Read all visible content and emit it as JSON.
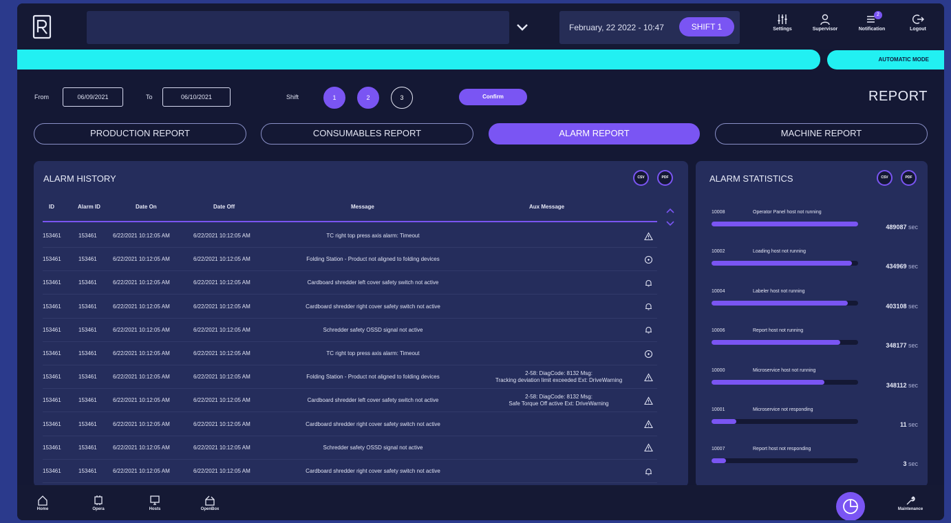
{
  "topbar": {
    "machine_select_value": "",
    "datetime": "February, 22 2022 - 10:47",
    "shift_label": "SHIFT 1",
    "settings_label": "Settings",
    "supervisor_label": "Supervisor",
    "notification_label": "Notification",
    "notification_count": "2",
    "logout_label": "Logout"
  },
  "mode": {
    "label": "AUTOMATIC MODE"
  },
  "filters": {
    "from_label": "From",
    "from_value": "06/09/2021",
    "to_label": "To",
    "to_value": "06/10/2021",
    "shift_label": "Shift",
    "shifts": [
      "1",
      "2",
      "3"
    ],
    "confirm_label": "Confirm"
  },
  "page_title": "REPORT",
  "tabs": [
    "PRODUCTION REPORT",
    "CONSUMABLES REPORT",
    "ALARM REPORT",
    "MACHINE REPORT"
  ],
  "alarm_history": {
    "title": "ALARM HISTORY",
    "csv_label": "CSV",
    "pdf_label": "PDF",
    "columns": [
      "ID",
      "Alarm ID",
      "Date On",
      "Date Off",
      "Message",
      "Aux Message"
    ],
    "rows": [
      {
        "id": "153461",
        "alarm_id": "153461",
        "date_on": "6/22/2021 10:12:05 AM",
        "date_off": "6/22/2021 10:12:05 AM",
        "message": "TC right top press axis alarm: Timeout",
        "aux1": "",
        "aux2": "",
        "icon": "warning-icon"
      },
      {
        "id": "153461",
        "alarm_id": "153461",
        "date_on": "6/22/2021 10:12:05 AM",
        "date_off": "6/22/2021 10:12:05 AM",
        "message": "Folding Station - Product not aligned to folding devices",
        "aux1": "",
        "aux2": "",
        "icon": "info-circle-icon"
      },
      {
        "id": "153461",
        "alarm_id": "153461",
        "date_on": "6/22/2021 10:12:05 AM",
        "date_off": "6/22/2021 10:12:05 AM",
        "message": "Cardboard shredder left cover safety switch not active",
        "aux1": "",
        "aux2": "",
        "icon": "bell-icon"
      },
      {
        "id": "153461",
        "alarm_id": "153461",
        "date_on": "6/22/2021 10:12:05 AM",
        "date_off": "6/22/2021 10:12:05 AM",
        "message": "Cardboard shredder right cover safety switch not active",
        "aux1": "",
        "aux2": "",
        "icon": "bell-icon"
      },
      {
        "id": "153461",
        "alarm_id": "153461",
        "date_on": "6/22/2021 10:12:05 AM",
        "date_off": "6/22/2021 10:12:05 AM",
        "message": "Schredder safety OSSD signal not active",
        "aux1": "",
        "aux2": "",
        "icon": "bell-icon"
      },
      {
        "id": "153461",
        "alarm_id": "153461",
        "date_on": "6/22/2021 10:12:05 AM",
        "date_off": "6/22/2021 10:12:05 AM",
        "message": "TC right top press axis alarm: Timeout",
        "aux1": "",
        "aux2": "",
        "icon": "info-circle-icon"
      },
      {
        "id": "153461",
        "alarm_id": "153461",
        "date_on": "6/22/2021 10:12:05 AM",
        "date_off": "6/22/2021 10:12:05 AM",
        "message": "Folding Station - Product not aligned to folding devices",
        "aux1": "2-58: DiagCode: 8132 Msg:",
        "aux2": "Tracking deviation limit exceeded Ext: DriveWarning",
        "icon": "warning-icon"
      },
      {
        "id": "153461",
        "alarm_id": "153461",
        "date_on": "6/22/2021 10:12:05 AM",
        "date_off": "6/22/2021 10:12:05 AM",
        "message": "Cardboard shredder left cover safety switch not active",
        "aux1": "2-58: DiagCode: 8132 Msg:",
        "aux2": "Safe Torque Off active Ext: DriveWarning",
        "icon": "warning-icon"
      },
      {
        "id": "153461",
        "alarm_id": "153461",
        "date_on": "6/22/2021 10:12:05 AM",
        "date_off": "6/22/2021 10:12:05 AM",
        "message": "Cardboard shredder right cover safety switch not active",
        "aux1": "",
        "aux2": "",
        "icon": "warning-icon"
      },
      {
        "id": "153461",
        "alarm_id": "153461",
        "date_on": "6/22/2021 10:12:05 AM",
        "date_off": "6/22/2021 10:12:05 AM",
        "message": "Schredder safety OSSD signal not active",
        "aux1": "",
        "aux2": "",
        "icon": "warning-icon"
      },
      {
        "id": "153461",
        "alarm_id": "153461",
        "date_on": "6/22/2021 10:12:05 AM",
        "date_off": "6/22/2021 10:12:05 AM",
        "message": "Cardboard shredder right cover safety switch not active",
        "aux1": "",
        "aux2": "",
        "icon": "bell-icon"
      }
    ]
  },
  "alarm_statistics": {
    "title": "ALARM STATISTICS",
    "csv_label": "CSV",
    "pdf_label": "PDF",
    "items": [
      {
        "id": "10008",
        "name": "Operator Panel host not running",
        "value": "489087",
        "unit": "sec",
        "fraction": 1.0
      },
      {
        "id": "10002",
        "name": "Loading host not running",
        "value": "434969",
        "unit": "sec",
        "fraction": 0.96
      },
      {
        "id": "10004",
        "name": "Labeler host not running",
        "value": "403108",
        "unit": "sec",
        "fraction": 0.93
      },
      {
        "id": "10006",
        "name": "Report host not running",
        "value": "348177",
        "unit": "sec",
        "fraction": 0.88
      },
      {
        "id": "10000",
        "name": "Microservice host not running",
        "value": "348112",
        "unit": "sec",
        "fraction": 0.77
      },
      {
        "id": "10001",
        "name": "Microservice not responding",
        "value": "11",
        "unit": "sec",
        "fraction": 0.17
      },
      {
        "id": "10007",
        "name": "Report host not responding",
        "value": "3",
        "unit": "sec",
        "fraction": 0.1
      }
    ]
  },
  "bottom_nav": {
    "home_label": "Home",
    "opera_label": "Opera",
    "hosts_label": "Hosts",
    "openbox_label": "OpenBox",
    "maintenance_label": "Maintenance"
  },
  "colors": {
    "accent": "#7a55f3",
    "cyan": "#22f0f2",
    "background": "#141834",
    "panel": "#252d5c",
    "frame": "#2b3a8c"
  }
}
